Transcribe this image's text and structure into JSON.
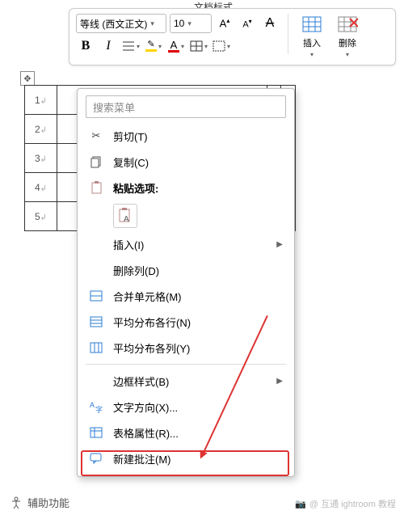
{
  "titlebar_fragment": "文档标式",
  "ribbon": {
    "font_name": "等线 (西文正文)",
    "font_size": "10",
    "grow_glyph": "A↑",
    "shrink_glyph": "A↓",
    "clear_glyph": "A",
    "bold": "B",
    "italic": "I",
    "highlight_letter": "ab",
    "fontcolor_letter": "A",
    "insert_label": "插入",
    "delete_label": "删除"
  },
  "table": {
    "rows": [
      "1",
      "2",
      "3",
      "4",
      "5"
    ],
    "cell_mark": "↲"
  },
  "context_menu": {
    "search_placeholder": "搜索菜单",
    "cut": "剪切(T)",
    "copy": "复制(C)",
    "paste_header": "粘贴选项:",
    "insert": "插入(I)",
    "delete_col": "删除列(D)",
    "merge": "合并单元格(M)",
    "dist_rows": "平均分布各行(N)",
    "dist_cols": "平均分布各列(Y)",
    "border_style": "边框样式(B)",
    "text_dir": "文字方向(X)...",
    "table_props": "表格属性(R)...",
    "new_comment": "新建批注(M)"
  },
  "footer": {
    "a11y": "辅助功能"
  },
  "watermark": "@ 互通 ightroom 教程"
}
